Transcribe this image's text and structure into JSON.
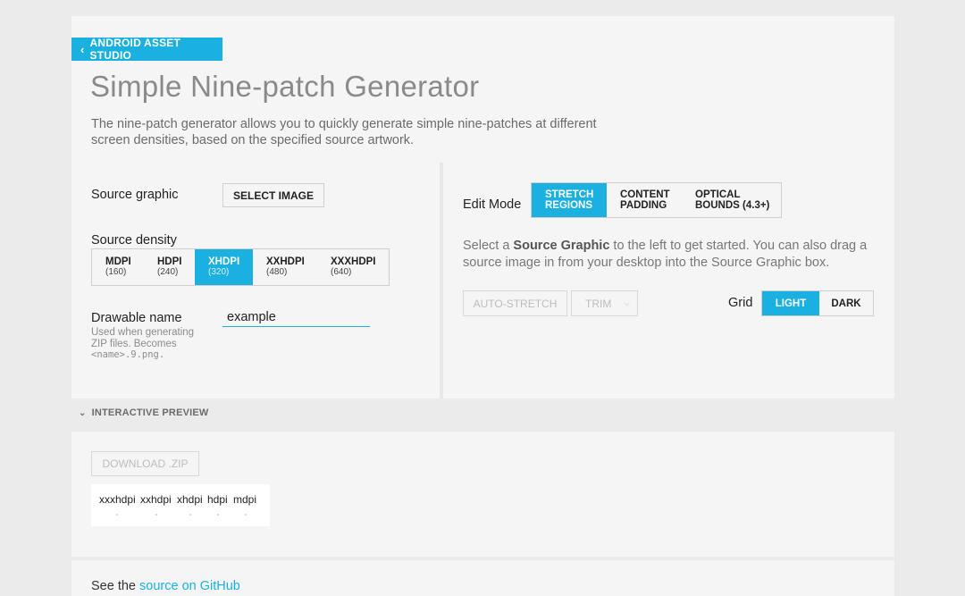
{
  "nav": {
    "back_label": "ANDROID ASSET STUDIO",
    "back_icon": "chevron-left-icon"
  },
  "header": {
    "title": "Simple Nine-patch Generator",
    "description": "The nine-patch generator allows you to quickly generate simple nine-patches at different screen densities, based on the specified source artwork."
  },
  "left_panel": {
    "source_graphic_label": "Source graphic",
    "select_image_button": "SELECT IMAGE",
    "source_density_label": "Source density",
    "densities": [
      {
        "name": "MDPI",
        "value": "(160)",
        "active": false
      },
      {
        "name": "HDPI",
        "value": "(240)",
        "active": false
      },
      {
        "name": "XHDPI",
        "value": "(320)",
        "active": true
      },
      {
        "name": "XXHDPI",
        "value": "(480)",
        "active": false
      },
      {
        "name": "XXXHDPI",
        "value": "(640)",
        "active": false
      }
    ],
    "drawable_name_label": "Drawable name",
    "drawable_name_value": "example",
    "drawable_hint_text": "Used when generating ZIP files. Becomes",
    "drawable_hint_code": "<name>.9.png."
  },
  "right_panel": {
    "edit_mode_label": "Edit Mode",
    "edit_modes": [
      {
        "line1": "STRETCH",
        "line2": "REGIONS",
        "active": true
      },
      {
        "line1": "CONTENT",
        "line2": "PADDING",
        "active": false
      },
      {
        "line1": "OPTICAL",
        "line2": "BOUNDS (4.3+)",
        "active": false
      }
    ],
    "message_pre": "Select a ",
    "message_bold": "Source Graphic",
    "message_post": " to the left to get started. You can also drag a source image in from your desktop into the Source Graphic box.",
    "auto_stretch_button": "AUTO-STRETCH",
    "trim_select": "TRIM",
    "grid_label": "Grid",
    "grid_options": [
      {
        "label": "LIGHT",
        "active": true
      },
      {
        "label": "DARK",
        "active": false
      }
    ]
  },
  "preview": {
    "header_label": "INTERACTIVE PREVIEW",
    "download_button": "DOWNLOAD .ZIP",
    "density_labels": [
      "xxxhdpi",
      "xxhdpi",
      "xhdpi",
      "hdpi",
      "mdpi"
    ]
  },
  "footer": {
    "text_pre": "See the ",
    "link_text": "source on GitHub"
  },
  "colors": {
    "accent": "#1ab0e0",
    "background": "#ebebeb",
    "card": "#f5f5f5"
  }
}
